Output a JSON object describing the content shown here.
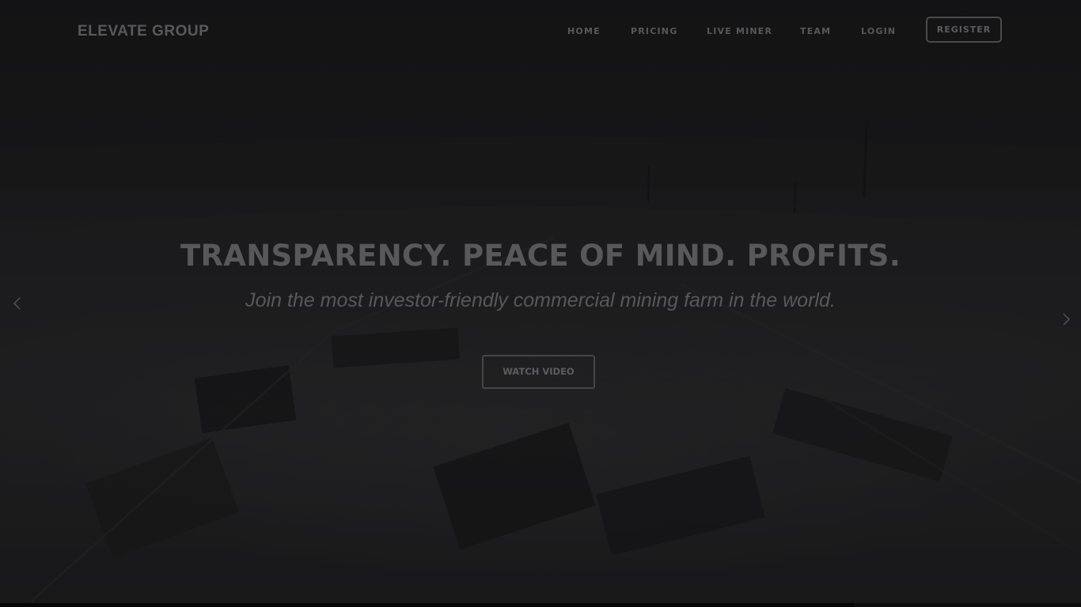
{
  "brand": {
    "logo_text": "ELEVATE GROUP"
  },
  "nav": {
    "items": [
      {
        "label": "HOME"
      },
      {
        "label": "PRICING"
      },
      {
        "label": "LIVE MINER"
      },
      {
        "label": "TEAM"
      },
      {
        "label": "LOGIN"
      }
    ],
    "register_label": "REGISTER"
  },
  "hero": {
    "headline": "TRANSPARENCY. PEACE OF MIND. PROFITS.",
    "subheadline": "Join the most investor-friendly commercial mining farm in the world.",
    "cta_label": "WATCH VIDEO",
    "prev_icon": "chevron-left-icon",
    "next_icon": "chevron-right-icon",
    "slide_progress": 0.79
  },
  "colors": {
    "background": "#111113",
    "text_dim": "#58585b",
    "border_dim": "#4a4a4d"
  }
}
